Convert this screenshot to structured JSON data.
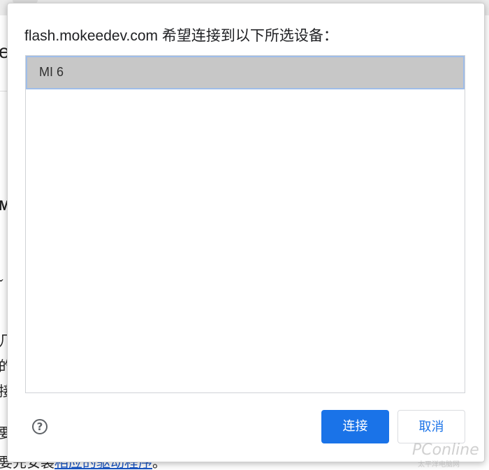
{
  "background_page": {
    "fragments": [
      "e",
      "M",
      "ˇ",
      "几",
      "的",
      "接",
      "要",
      "要先安装",
      "相应的驱动程序",
      "。"
    ]
  },
  "dialog": {
    "title": "flash.mokeedev.com 希望连接到以下所选设备：",
    "devices": [
      {
        "label": "MI 6",
        "selected": true
      }
    ],
    "help_icon": "question-mark-icon",
    "connect_label": "连接",
    "cancel_label": "取消",
    "accent_color": "#1a73e8"
  },
  "watermark": {
    "text": "PConline",
    "subtext": "太平洋电脑网"
  }
}
